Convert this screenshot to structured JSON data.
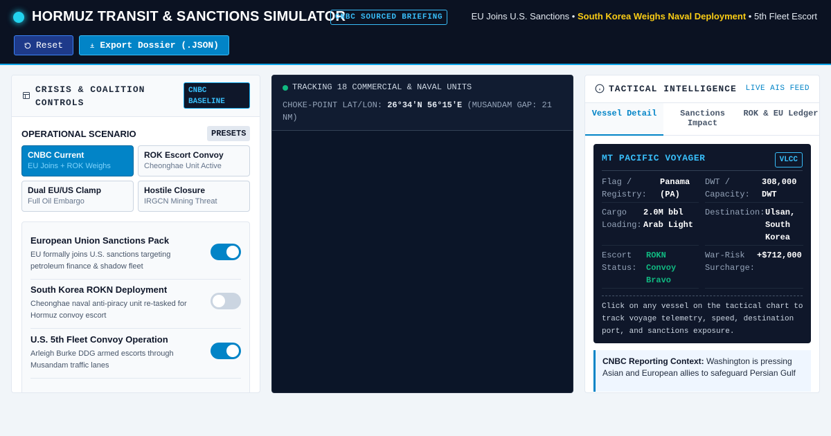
{
  "header": {
    "title": "HORMUZ TRANSIT & SANCTIONS SIMULATOR",
    "badge": "CNBC SOURCED BRIEFING",
    "ticker_part1": "EU Joins U.S. Sanctions •",
    "ticker_highlight": "South Korea Weighs Naval Deployment",
    "ticker_part2": "• 5th Fleet Escort",
    "reset_label": "Reset",
    "export_label": "Export Dossier (.JSON)",
    "colors": {
      "accent": "#0ea5e9",
      "highlight": "#facc15",
      "background": "#0b1222"
    }
  },
  "controls": {
    "title": "CRISIS & COALITION CONTROLS",
    "badge": "CNBC BASELINE",
    "scenario_label": "OPERATIONAL SCENARIO",
    "presets_label": "PRESETS",
    "scenarios": [
      {
        "name": "CNBC Current",
        "sub": "EU Joins + ROK Weighs",
        "active": true
      },
      {
        "name": "ROK Escort Convoy",
        "sub": "Cheonghae Unit Active",
        "active": false
      },
      {
        "name": "Dual EU/US Clamp",
        "sub": "Full Oil Embargo",
        "active": false
      },
      {
        "name": "Hostile Closure",
        "sub": "IRGCN Mining Threat",
        "active": false
      }
    ],
    "toggles": [
      {
        "name": "European Union Sanctions Pack",
        "desc": "EU formally joins U.S. sanctions targeting petroleum finance & shadow fleet",
        "on": true
      },
      {
        "name": "South Korea ROKN Deployment",
        "desc": "Cheonghae naval anti-piracy unit re-tasked for Hormuz convoy escort",
        "on": false
      },
      {
        "name": "U.S. 5th Fleet Convoy Operation",
        "desc": "Arleigh Burke DDG armed escorts through Musandam traffic lanes",
        "on": true
      }
    ]
  },
  "map": {
    "tracking": "TRACKING 18 COMMERCIAL & NAVAL UNITS",
    "choke_label": "CHOKE-POINT LAT/LON:",
    "choke_value": "26°34'N 56°15'E",
    "choke_suffix": "(MUSANDAM GAP: 21 NM)"
  },
  "intel": {
    "title": "TACTICAL INTELLIGENCE",
    "feed": "LIVE AIS FEED",
    "tabs": [
      "Vessel Detail",
      "Sanctions Impact",
      "ROK & EU Ledger"
    ],
    "active_tab": 0,
    "vessel": {
      "name": "MT PACIFIC VOYAGER",
      "type": "VLCC",
      "flag_label": "Flag / Registry:",
      "flag_value": "Panama (PA)",
      "dwt_label": "DWT / Capacity:",
      "dwt_value": "308,000 DWT",
      "cargo_label": "Cargo Loading:",
      "cargo_value": "2.0M bbl Arab Light",
      "dest_label": "Destination:",
      "dest_value": "Ulsan, South Korea",
      "escort_label": "Escort Status:",
      "escort_value": "ROKN Convoy Bravo",
      "risk_label": "War-Risk Surcharge:",
      "risk_value": "+$712,000",
      "note": "Click on any vessel on the tactical chart to track voyage telemetry, speed, destination port, and sanctions exposure."
    },
    "context_label": "CNBC Reporting Context:",
    "context_text": "Washington is pressing Asian and European allies to safeguard Persian Gulf"
  }
}
